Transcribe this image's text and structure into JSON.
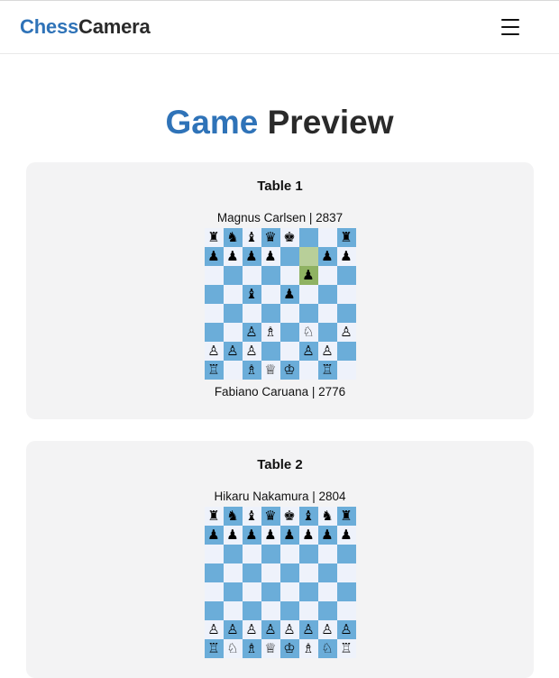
{
  "header": {
    "logo_part1": "Chess",
    "logo_part2": "Camera",
    "menu_icon": "hamburger-menu-icon"
  },
  "page": {
    "title_part1": "Game",
    "title_part2": "Preview"
  },
  "colors": {
    "accent": "#2f73b8",
    "dark_square": "#6badd9",
    "light_square": "#eef2fb",
    "highlight_light": "#b8cf99",
    "highlight_dark": "#8fb262",
    "card_bg": "#f3f3f4"
  },
  "tables": [
    {
      "title": "Table 1",
      "top_player": "Magnus Carlsen | 2837",
      "bottom_player": "Fabiano Caruana | 2776",
      "board": [
        "♜♞♝♛♚..♜",
        "♟♟♟♟..♟♟",
        ".....♟..",
        "..♝.♟...",
        "........",
        "..♙♗.♘.♙",
        "♙♙♙..♙♙.",
        "♖.♗♕♔.♖."
      ],
      "highlights": [
        [
          1,
          5
        ],
        [
          2,
          5
        ]
      ]
    },
    {
      "title": "Table 2",
      "top_player": "Hikaru Nakamura | 2804",
      "bottom_player": "",
      "board": [
        "♜♞♝♛♚♝♞♜",
        "♟♟♟♟♟♟♟♟",
        "........",
        "........",
        "........",
        "........",
        "♙♙♙♙♙♙♙♙",
        "♖♘♗♕♔♗♘♖"
      ],
      "highlights": []
    }
  ]
}
